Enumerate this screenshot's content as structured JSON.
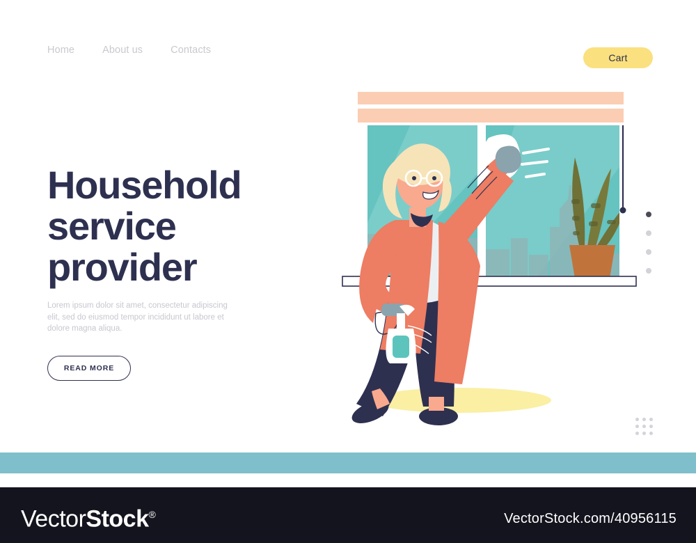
{
  "nav": {
    "links": [
      {
        "label": "Home",
        "name": "nav-link-home"
      },
      {
        "label": "About us",
        "name": "nav-link-about-us"
      },
      {
        "label": "Contacts",
        "name": "nav-link-contacts"
      }
    ],
    "cart_label": "Cart"
  },
  "hero": {
    "title_line1": "Household",
    "title_line2": "service",
    "title_line3": "provider",
    "subtitle": "Lorem ipsum dolor sit amet, consectetur adipiscing elit, sed do eiusmod tempor incididunt ut labore et dolore magna aliqua.",
    "cta_label": "READ MORE"
  },
  "pagination": {
    "dots": [
      {
        "active": true
      },
      {
        "active": false
      },
      {
        "active": false
      },
      {
        "active": false
      }
    ]
  },
  "illustration": {
    "alt": "woman cleaning a window with spray bottle and cloth",
    "elements": [
      "window-frame",
      "window-blinds",
      "window-glass",
      "city-skyline",
      "snake-plant",
      "plant-pot",
      "blind-cord",
      "windowsill",
      "woman-character",
      "spray-bottle",
      "cleaning-cloth",
      "motion-lines",
      "floor-shadow"
    ]
  },
  "footer": {
    "logo_light": "Vector",
    "logo_bold": "Stock",
    "logo_reg": "®",
    "url": "VectorStock.com/40956115"
  },
  "colors": {
    "navy": "#2e3050",
    "footer_bg": "#14141f",
    "accent_yellow": "#fbe07f",
    "teal_band": "#7fbfcb",
    "glass_teal": "#65c3c0",
    "glass_teal_light": "#8ed6d2",
    "coat_salmon": "#ed7d63",
    "hair_blonde": "#f7e3b8",
    "skin": "#f9a98e",
    "trousers_navy": "#2e3050",
    "plant_olive": "#6f7137",
    "pot_terracotta": "#c0743c",
    "blind_peach": "#fbcdb3",
    "skyline_gray": "#8fb6b8",
    "shadow_yellow": "#faefa3",
    "muted_text": "#c9c9cf"
  }
}
